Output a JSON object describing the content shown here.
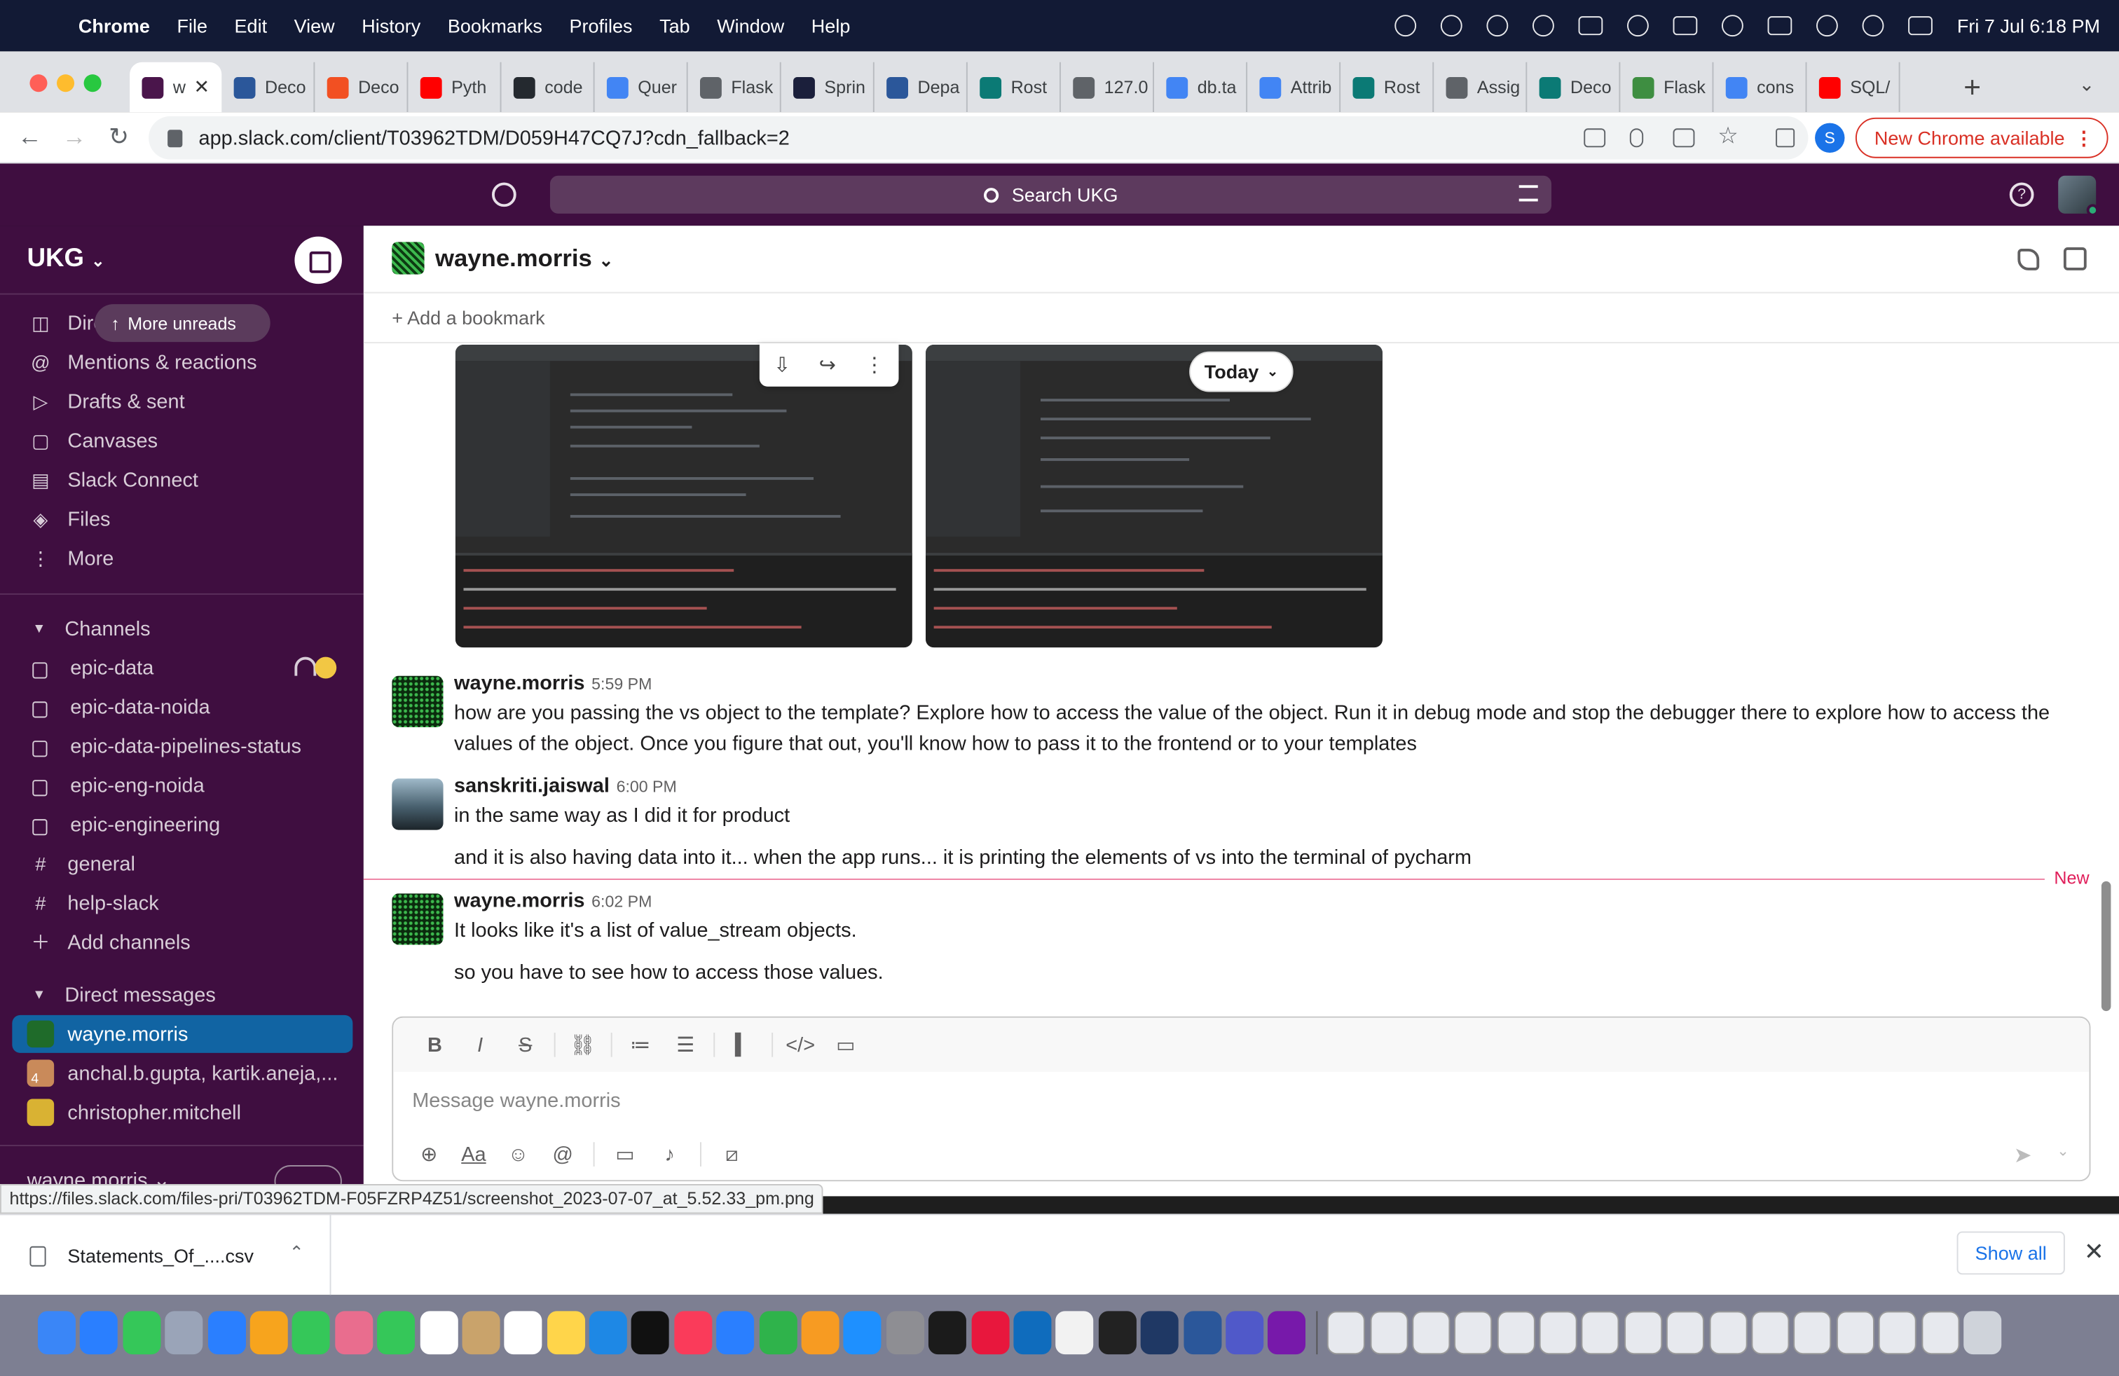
{
  "menubar": {
    "app": "Chrome",
    "items": [
      "File",
      "Edit",
      "View",
      "History",
      "Bookmarks",
      "Profiles",
      "Tab",
      "Window",
      "Help"
    ],
    "datetime": "Fri 7 Jul  6:18 PM"
  },
  "tabs": [
    {
      "label": "w",
      "color": "#4a154b"
    },
    {
      "label": "Deco",
      "color": "#2b579a"
    },
    {
      "label": "Deco",
      "color": "#f25022"
    },
    {
      "label": "Pyth",
      "color": "#ff0000"
    },
    {
      "label": "code",
      "color": "#24292f"
    },
    {
      "label": "Quer",
      "color": "#4285f4"
    },
    {
      "label": "Flask",
      "color": "#5f6368"
    },
    {
      "label": "Sprin",
      "color": "#1b1f3b"
    },
    {
      "label": "Depa",
      "color": "#2b579a"
    },
    {
      "label": "Rost",
      "color": "#0b7a75"
    },
    {
      "label": "127.0",
      "color": "#5f6368"
    },
    {
      "label": "db.ta",
      "color": "#4285f4"
    },
    {
      "label": "Attrib",
      "color": "#4285f4"
    },
    {
      "label": "Rost",
      "color": "#0b7a75"
    },
    {
      "label": "Assig",
      "color": "#5f6368"
    },
    {
      "label": "Deco",
      "color": "#0b7a75"
    },
    {
      "label": "Flask",
      "color": "#3e8e41"
    },
    {
      "label": "cons",
      "color": "#4285f4"
    },
    {
      "label": "SQL/",
      "color": "#ff0000"
    }
  ],
  "address": {
    "url": "app.slack.com/client/T03962TDM/D059H47CQ7J?cdn_fallback=2",
    "profile_initial": "S",
    "update_label": "New Chrome available"
  },
  "slack_top": {
    "search_placeholder": "Search UKG"
  },
  "sidebar": {
    "workspace": "UKG",
    "more_unreads": "More unreads",
    "nav": [
      {
        "label": "Direct messages",
        "icon": "dm-icon",
        "glyph": "◫"
      },
      {
        "label": "Mentions & reactions",
        "icon": "at-icon",
        "glyph": "@"
      },
      {
        "label": "Drafts & sent",
        "icon": "send-icon",
        "glyph": "▷"
      },
      {
        "label": "Canvases",
        "icon": "canvas-icon",
        "glyph": "▢"
      },
      {
        "label": "Slack Connect",
        "icon": "building-icon",
        "glyph": "▤"
      },
      {
        "label": "Files",
        "icon": "files-icon",
        "glyph": "◈"
      },
      {
        "label": "More",
        "icon": "more-icon",
        "glyph": "⋮"
      }
    ],
    "channels_header": "Channels",
    "channels": [
      {
        "label": "epic-data",
        "private": true
      },
      {
        "label": "epic-data-noida",
        "private": true
      },
      {
        "label": "epic-data-pipelines-status",
        "private": true
      },
      {
        "label": "epic-eng-noida",
        "private": true
      },
      {
        "label": "epic-engineering",
        "private": true
      },
      {
        "label": "general",
        "private": false
      },
      {
        "label": "help-slack",
        "private": false
      }
    ],
    "add_channels": "Add channels",
    "dm_header": "Direct messages",
    "dms": [
      {
        "label": "wayne.morris",
        "selected": true,
        "avatar_color": "#1f6b2a"
      },
      {
        "label": "anchal.b.gupta, kartik.aneja,...",
        "selected": false,
        "avatar_color": "#c98a5a",
        "count": "4"
      },
      {
        "label": "christopher.mitchell",
        "selected": false,
        "avatar_color": "#d9b233"
      }
    ],
    "footer_user": "wayne.morris"
  },
  "channel": {
    "name": "wayne.morris",
    "add_bookmark": "Add a bookmark",
    "date_divider": "Today",
    "new_label": "New"
  },
  "messages": [
    {
      "author": "wayne.morris",
      "time": "5:59 PM",
      "lines": [
        "how are you passing the vs object to the template? Explore how to access the value of the object. Run it in debug mode and stop the debugger there to explore how to access the",
        "values of the object. Once you figure that out, you'll know how to pass it to the frontend or to your templates"
      ]
    },
    {
      "author": "sanskriti.jaiswal",
      "time": "6:00 PM",
      "lines": [
        "in the same way as I did it for product",
        "and it is also having data into it... when the app runs... it is printing the elements of vs into the terminal of pycharm"
      ]
    },
    {
      "author": "wayne.morris",
      "time": "6:02 PM",
      "lines": [
        "It looks like it's a list of value_stream objects.",
        "so you have to see how to access those values."
      ]
    }
  ],
  "composer": {
    "placeholder": "Message wayne.morris"
  },
  "status_url": "https://files.slack.com/files-pri/T03962TDM-F05FZRP4Z51/screenshot_2023-07-07_at_5.52.33_pm.png",
  "downloads": {
    "file": "Statements_Of_....csv",
    "show_all": "Show all"
  },
  "dock": {
    "apps": [
      "Finder",
      "Safari",
      "Messages",
      "Launchpad",
      "Mail",
      "Photos",
      "Maps",
      "Photos2",
      "FaceTime",
      "Calendar",
      "Contacts",
      "Reminders",
      "Notes",
      "Freeform",
      "TV",
      "Music",
      "Keynote",
      "Numbers",
      "Pages",
      "App Store",
      "System Settings",
      "PyCharm",
      "InDesign",
      "Outlook",
      "Chrome",
      "Terminal",
      "Word-like",
      "Word",
      "Teams",
      "OneNote"
    ],
    "colors": [
      "#3a86f7",
      "#2a7fff",
      "#35c759",
      "#9aa4b8",
      "#2a7fff",
      "#f7a41d",
      "#35c759",
      "#e96d8e",
      "#35c759",
      "#ffffff",
      "#c9a36b",
      "#ffffff",
      "#ffd54a",
      "#1e88e5",
      "#111111",
      "#fa3b5a",
      "#2a7fff",
      "#2fb34b",
      "#f79b22",
      "#1e90ff",
      "#8e8e93",
      "#1b1b1b",
      "#e8173d",
      "#0f6cbd",
      "#f2f2f2",
      "#222222",
      "#1f3864",
      "#2b579a",
      "#5059c9",
      "#7719aa"
    ]
  }
}
